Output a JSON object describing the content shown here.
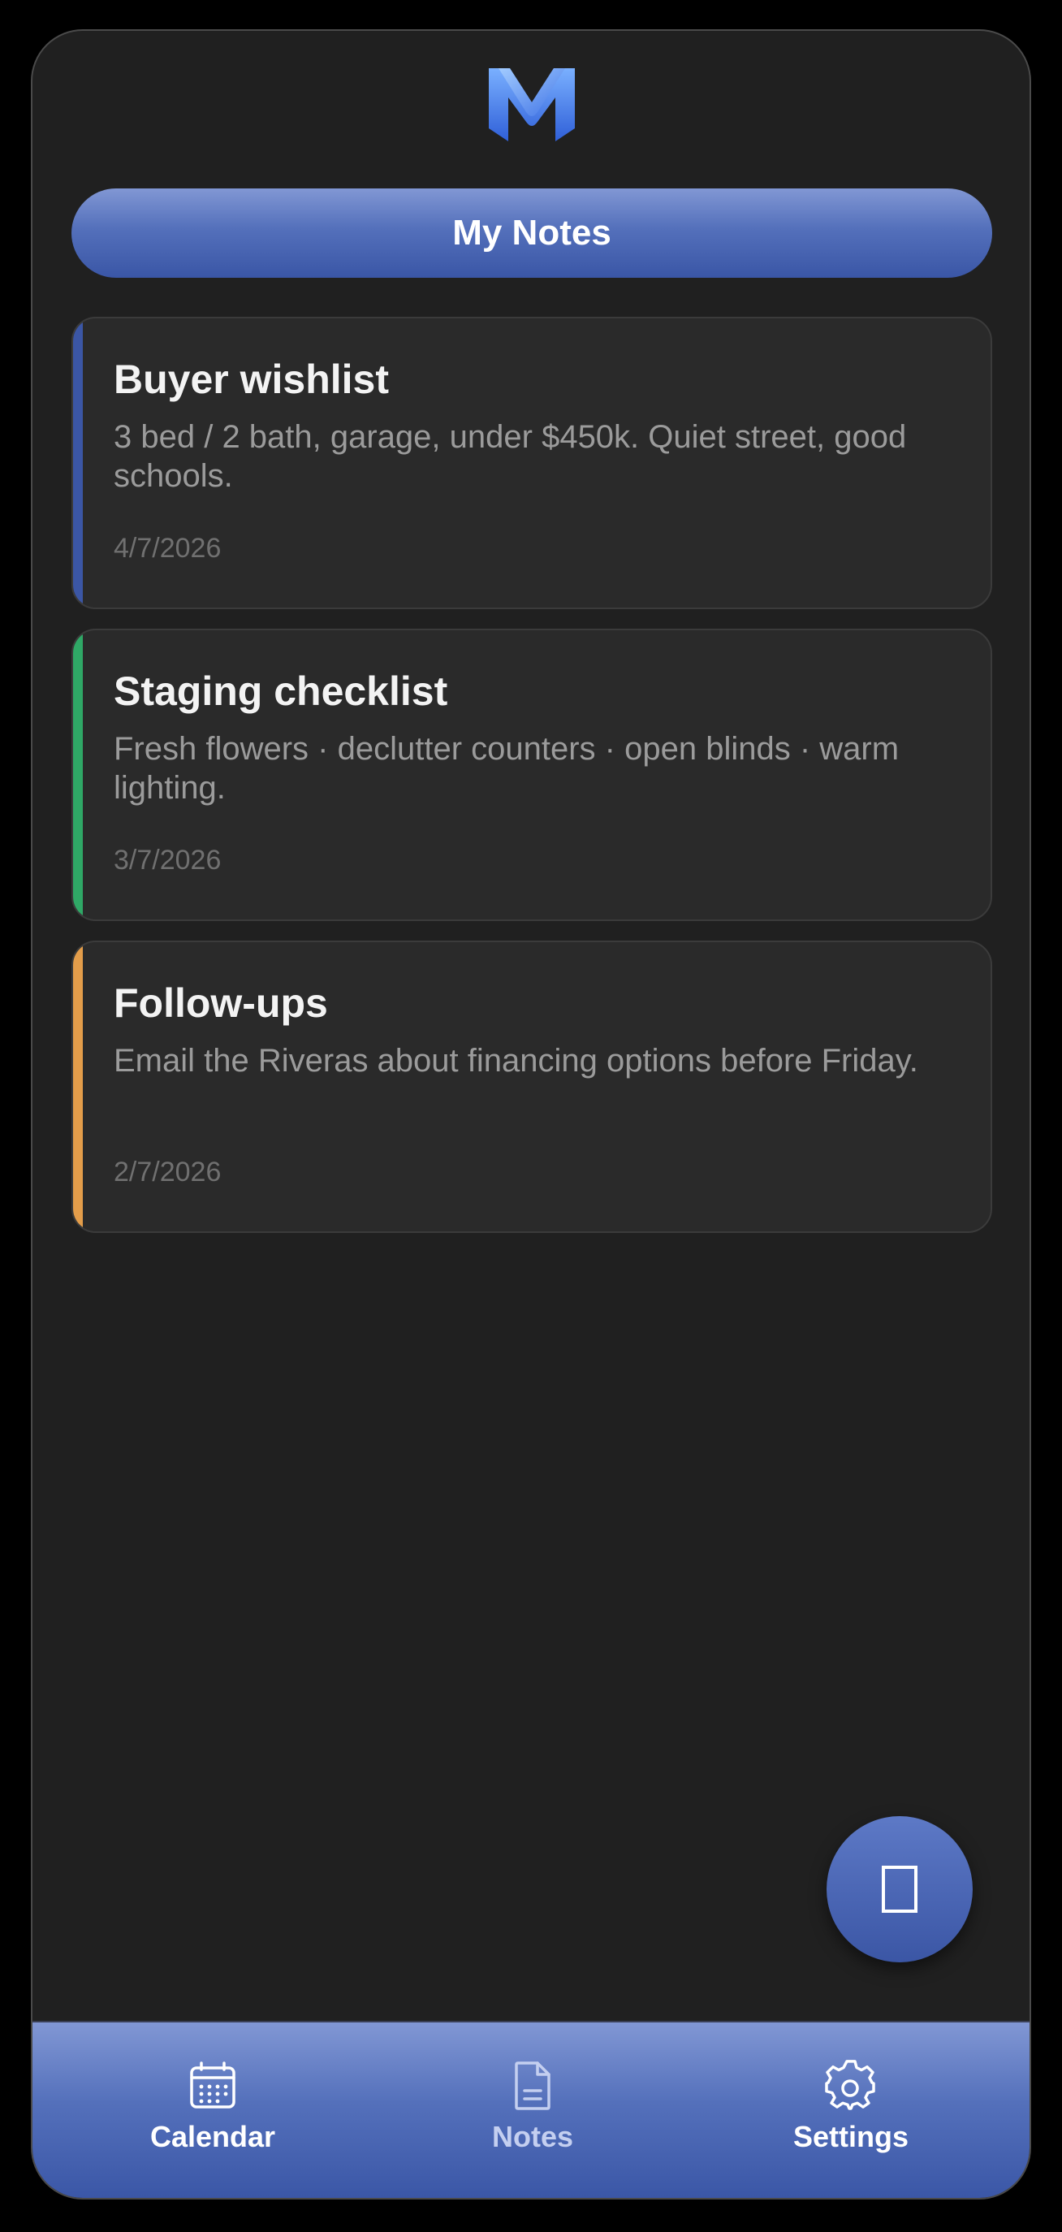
{
  "header": {
    "logo_icon": "m-logo-icon",
    "title": "My Notes"
  },
  "notes": [
    {
      "title": "Buyer wishlist",
      "body": "3 bed / 2 bath, garage, under $450k. Quiet street, good schools.",
      "date": "4/7/2026",
      "accent": "#3b56a5"
    },
    {
      "title": "Staging checklist",
      "body": "Fresh flowers · declutter counters · open blinds · warm lighting.",
      "date": "3/7/2026",
      "accent": "#2fa866"
    },
    {
      "title": "Follow-ups",
      "body": "Email the Riveras about financing options before Friday.",
      "date": "2/7/2026",
      "accent": "#e39d4a"
    }
  ],
  "fab": {
    "icon": "new-note-icon"
  },
  "nav": {
    "items": [
      {
        "label": "Calendar",
        "icon": "calendar-icon",
        "active": false
      },
      {
        "label": "Notes",
        "icon": "document-icon",
        "active": true
      },
      {
        "label": "Settings",
        "icon": "gear-icon",
        "active": false
      }
    ]
  },
  "colors": {
    "background": "#202020",
    "card": "#2a2a2a",
    "brand_blue": "#3b56a5",
    "brand_blue_light": "#8197d4"
  }
}
